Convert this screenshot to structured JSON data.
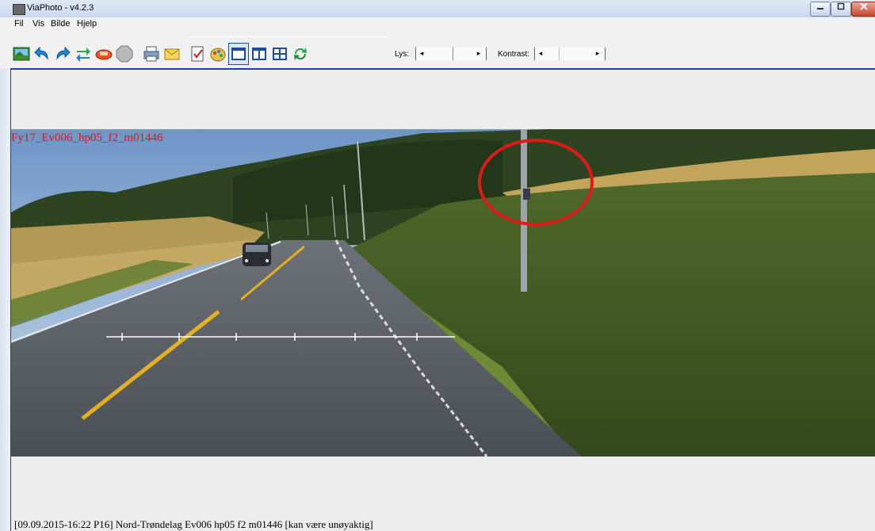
{
  "window": {
    "title": "ViaPhoto - v4.2.3"
  },
  "menu": [
    "Fil",
    "Vis",
    "Bilde",
    "Hjelp"
  ],
  "toolbar": {
    "buttons": [
      {
        "name": "open-image-icon"
      },
      {
        "name": "back-icon"
      },
      {
        "name": "forward-icon"
      },
      {
        "name": "swap-direction-icon"
      },
      {
        "name": "car-icon"
      },
      {
        "name": "stop-icon"
      },
      {
        "name": "print-icon"
      },
      {
        "name": "email-icon"
      },
      {
        "name": "report-icon"
      },
      {
        "name": "paint-icon"
      },
      {
        "name": "single-view-icon"
      },
      {
        "name": "double-view-icon"
      },
      {
        "name": "quad-view-icon"
      },
      {
        "name": "refresh-icon"
      }
    ],
    "brightness_label": "Lys:",
    "contrast_label": "Kontrast:"
  },
  "photo": {
    "label": "Fy17_Ev006_hp05_f2_m01446"
  },
  "status": "[09.09.2015-16:22  P16]  Nord-Trøndelag Ev006 hp05 f2 m01446  [kan være unøyaktig]"
}
